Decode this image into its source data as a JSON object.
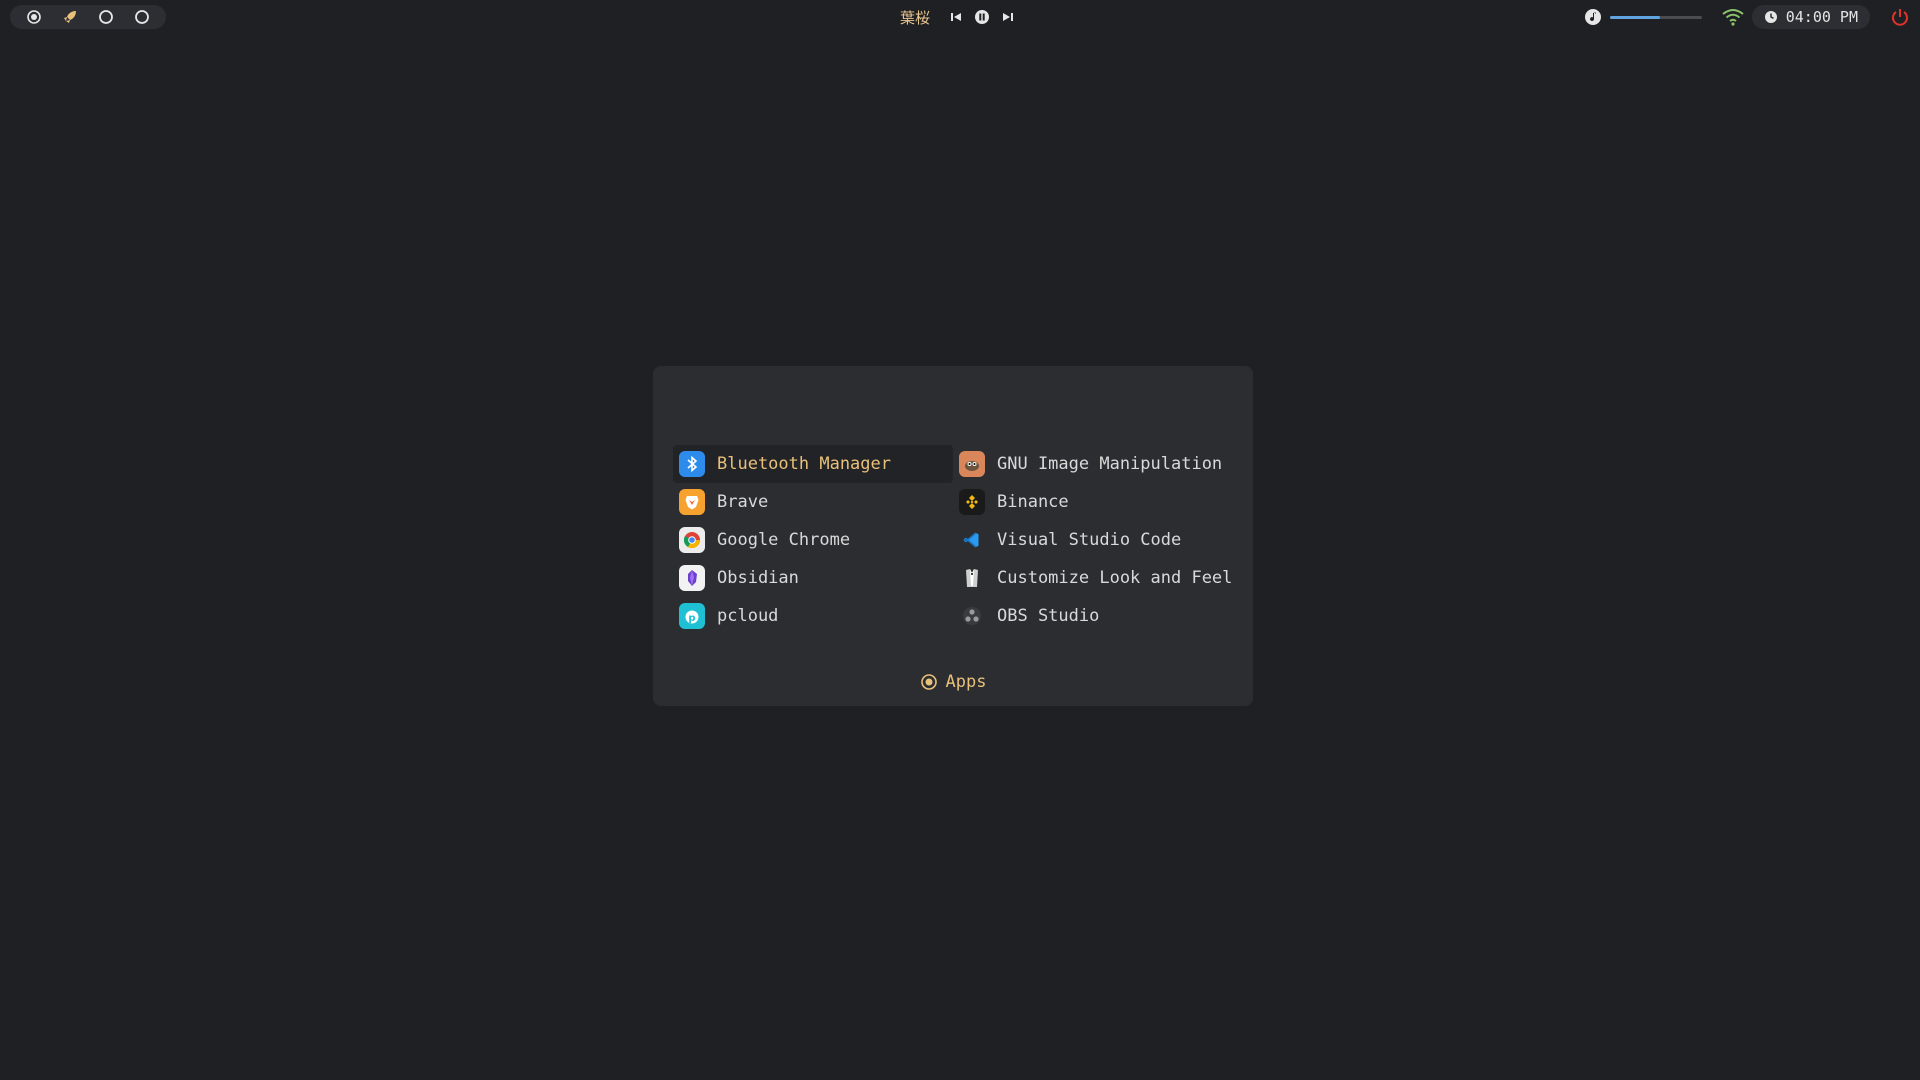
{
  "taskbar": {
    "workspaces": [
      {
        "icon": "record-icon"
      },
      {
        "icon": "rocket-icon"
      },
      {
        "icon": "ring-icon"
      },
      {
        "icon": "ring-icon"
      }
    ],
    "media": {
      "song": "葉桜",
      "prev_icon": "skip-back-icon",
      "pause_icon": "pause-icon",
      "next_icon": "skip-forward-icon"
    },
    "volume": {
      "icon": "music-note-icon",
      "level": 0.55,
      "accent": "#5fa3e0"
    },
    "wifi_icon": "wifi-icon",
    "clock": {
      "icon": "clock-icon",
      "time": "04:00 PM"
    },
    "power_icon": "power-icon",
    "power_color": "#e0342b"
  },
  "launcher": {
    "search_value": "",
    "apps": [
      {
        "label": "Bluetooth Manager",
        "icon": "bluetooth-icon",
        "selected": true
      },
      {
        "label": "GNU Image Manipulation P…",
        "icon": "gimp-icon"
      },
      {
        "label": "Brave",
        "icon": "brave-icon"
      },
      {
        "label": "Binance",
        "icon": "binance-icon"
      },
      {
        "label": "Google Chrome",
        "icon": "chrome-icon"
      },
      {
        "label": "Visual Studio Code",
        "icon": "vscode-icon"
      },
      {
        "label": "Obsidian",
        "icon": "obsidian-icon"
      },
      {
        "label": "Customize Look and Feel",
        "icon": "tuxedo-icon"
      },
      {
        "label": "pcloud",
        "icon": "pcloud-icon"
      },
      {
        "label": "OBS Studio",
        "icon": "obs-icon"
      }
    ],
    "mode": {
      "icon": "apps-mode-icon",
      "label": "Apps"
    },
    "accent": "#e8c07a"
  }
}
